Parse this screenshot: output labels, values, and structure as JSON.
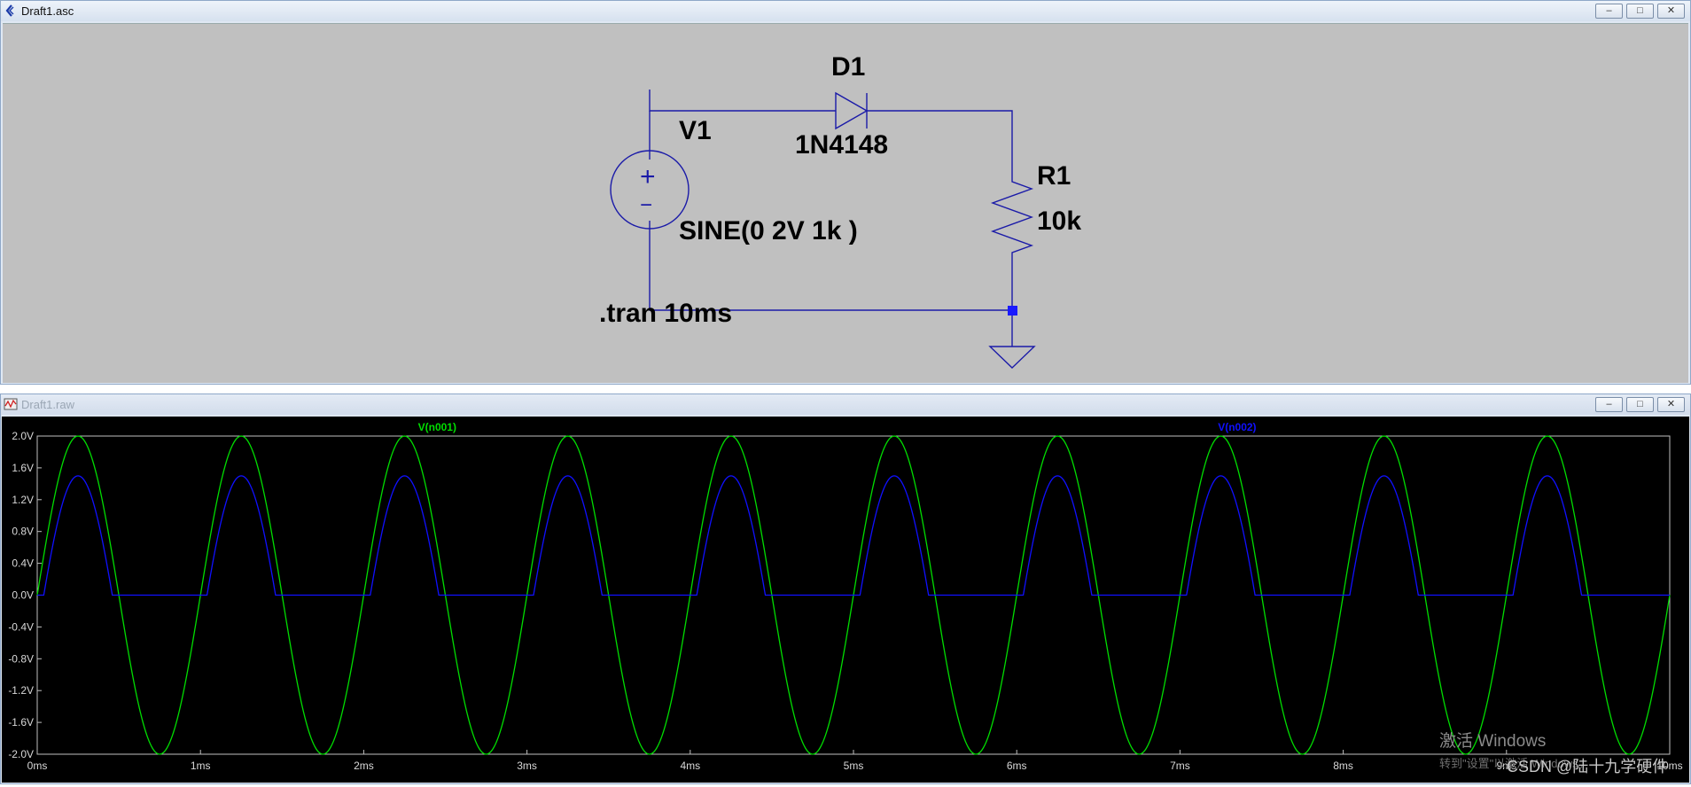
{
  "schematic_window": {
    "title": "Draft1.asc",
    "controls": [
      "‒",
      "□",
      "✕"
    ]
  },
  "schematic": {
    "diode_ref": "D1",
    "diode_model": "1N4148",
    "source_ref": "V1",
    "source_value": "SINE(0 2V 1k )",
    "resistor_ref": "R1",
    "resistor_value": "10k",
    "directive": ".tran 10ms",
    "plus_sign": "+",
    "minus_sign": "−"
  },
  "waveform_window": {
    "title": "Draft1.raw",
    "controls": [
      "‒",
      "□",
      "✕"
    ]
  },
  "chart_data": {
    "type": "line",
    "title": "",
    "xlabel": "",
    "ylabel": "",
    "x_ticks": [
      "0ms",
      "1ms",
      "2ms",
      "3ms",
      "4ms",
      "5ms",
      "6ms",
      "7ms",
      "8ms",
      "9ms",
      "10ms"
    ],
    "y_ticks": [
      "2.0V",
      "1.6V",
      "1.2V",
      "0.8V",
      "0.4V",
      "0.0V",
      "-0.4V",
      "-0.8V",
      "-1.2V",
      "-1.6V",
      "-2.0V"
    ],
    "xlim_ms": [
      0,
      10
    ],
    "ylim_V": [
      -2,
      2
    ],
    "grid": false,
    "series": [
      {
        "name": "V(n001)",
        "color": "#00dd00",
        "function": "2*sin(2*pi*1000*t)",
        "amplitude_V": 2.0,
        "frequency_Hz": 1000
      },
      {
        "name": "V(n002)",
        "color": "#1010ff",
        "function": "max(0, 2*sin(2*pi*1000*t) - 0.5)",
        "peak_V": 1.5,
        "diode_drop_V": 0.5
      }
    ]
  },
  "watermark": {
    "line1": "激活 Windows",
    "line2": "转到\"设置\"以激活 Windows。",
    "credit": "CSDN @陆十九学硬件"
  },
  "colors": {
    "schematic_bg": "#c0c0c0",
    "wire": "#1a1aa8",
    "plot_bg": "#000000",
    "axis_text": "#d8d8d8"
  }
}
